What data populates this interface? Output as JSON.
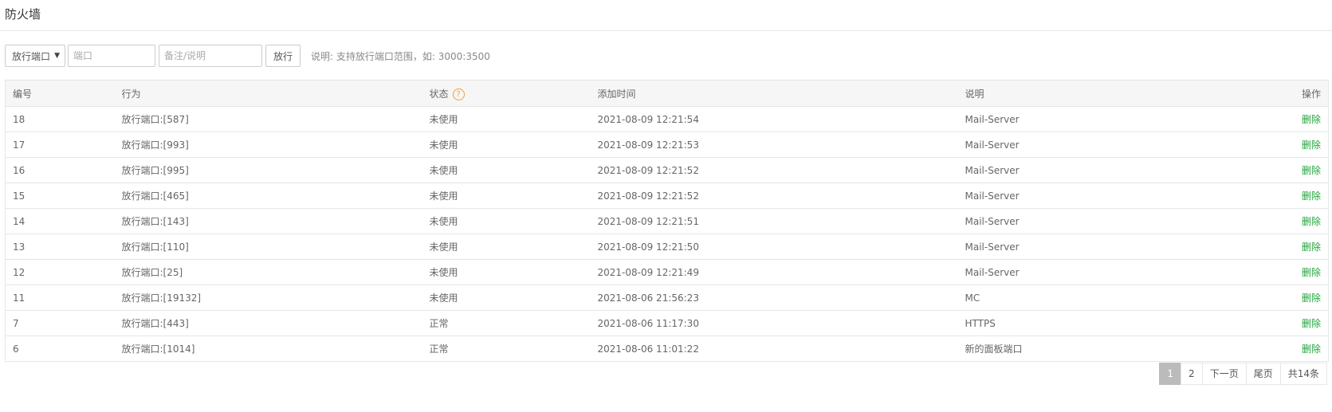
{
  "header": {
    "title": "防火墙"
  },
  "toolbar": {
    "select_value": "放行端口",
    "port_placeholder": "端口",
    "note_placeholder": "备注/说明",
    "submit_label": "放行",
    "hint": "说明: 支持放行端口范围，如: 3000:3500"
  },
  "table": {
    "columns": [
      "编号",
      "行为",
      "状态",
      "添加时间",
      "说明",
      "操作"
    ],
    "rows": [
      {
        "id": "18",
        "action": "放行端口:[587]",
        "status": "未使用",
        "time": "2021-08-09 12:21:54",
        "note": "Mail-Server",
        "op": "删除"
      },
      {
        "id": "17",
        "action": "放行端口:[993]",
        "status": "未使用",
        "time": "2021-08-09 12:21:53",
        "note": "Mail-Server",
        "op": "删除"
      },
      {
        "id": "16",
        "action": "放行端口:[995]",
        "status": "未使用",
        "time": "2021-08-09 12:21:52",
        "note": "Mail-Server",
        "op": "删除"
      },
      {
        "id": "15",
        "action": "放行端口:[465]",
        "status": "未使用",
        "time": "2021-08-09 12:21:52",
        "note": "Mail-Server",
        "op": "删除"
      },
      {
        "id": "14",
        "action": "放行端口:[143]",
        "status": "未使用",
        "time": "2021-08-09 12:21:51",
        "note": "Mail-Server",
        "op": "删除"
      },
      {
        "id": "13",
        "action": "放行端口:[110]",
        "status": "未使用",
        "time": "2021-08-09 12:21:50",
        "note": "Mail-Server",
        "op": "删除"
      },
      {
        "id": "12",
        "action": "放行端口:[25]",
        "status": "未使用",
        "time": "2021-08-09 12:21:49",
        "note": "Mail-Server",
        "op": "删除"
      },
      {
        "id": "11",
        "action": "放行端口:[19132]",
        "status": "未使用",
        "time": "2021-08-06 21:56:23",
        "note": "MC",
        "op": "删除"
      },
      {
        "id": "7",
        "action": "放行端口:[443]",
        "status": "正常",
        "time": "2021-08-06 11:17:30",
        "note": "HTTPS",
        "op": "删除"
      },
      {
        "id": "6",
        "action": "放行端口:[1014]",
        "status": "正常",
        "time": "2021-08-06 11:01:22",
        "note": "新的面板端口",
        "op": "删除"
      }
    ]
  },
  "pagination": {
    "current": "1",
    "page2": "2",
    "next": "下一页",
    "last": "尾页",
    "total": "共14条"
  },
  "colors": {
    "accent_green": "#20a53a",
    "help_orange": "#f0a13a"
  }
}
